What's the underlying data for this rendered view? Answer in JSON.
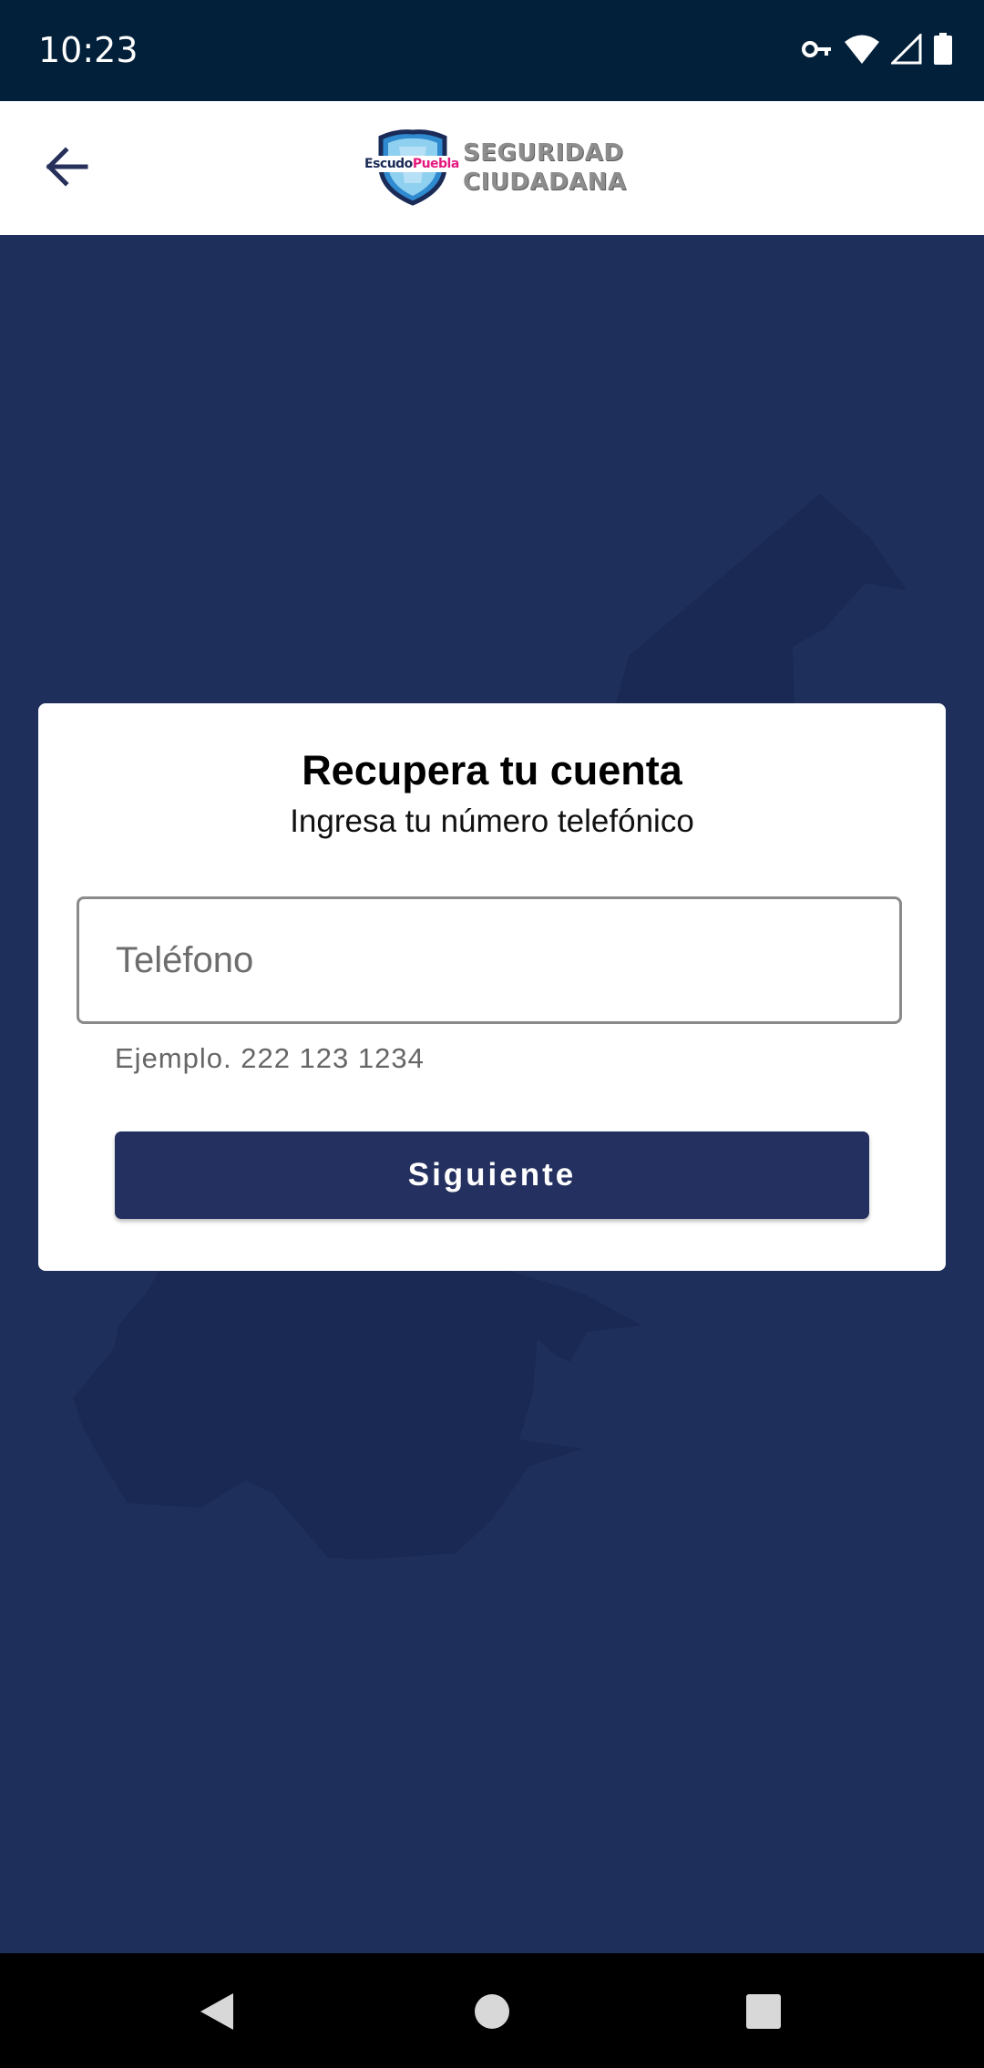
{
  "status_bar": {
    "time": "10:23",
    "icons": [
      "vpn-key-icon",
      "wifi-icon",
      "cell-signal-icon",
      "battery-icon"
    ]
  },
  "app_bar": {
    "back_icon": "arrow-left-icon",
    "logo": {
      "shield_text_1": "Escudo",
      "shield_text_2": "Puebla",
      "line1": "SEGURIDAD",
      "line2": "CIUDADANA"
    }
  },
  "recovery_card": {
    "title": "Recupera tu cuenta",
    "subtitle": "Ingresa tu número telefónico",
    "phone_input": {
      "value": "",
      "placeholder": "Teléfono"
    },
    "helper_text": "Ejemplo. 222 123 1234",
    "next_button_label": "Siguiente"
  },
  "colors": {
    "background": "#1f2f5c",
    "map_shape": "#1a2953",
    "status_bar": "#03203a",
    "primary_button": "#24305f",
    "logo_pink": "#e5197f",
    "logo_blue": "#2f8ad0"
  },
  "nav_bar": {
    "buttons": [
      "back-triangle-icon",
      "home-circle-icon",
      "recents-square-icon"
    ]
  }
}
